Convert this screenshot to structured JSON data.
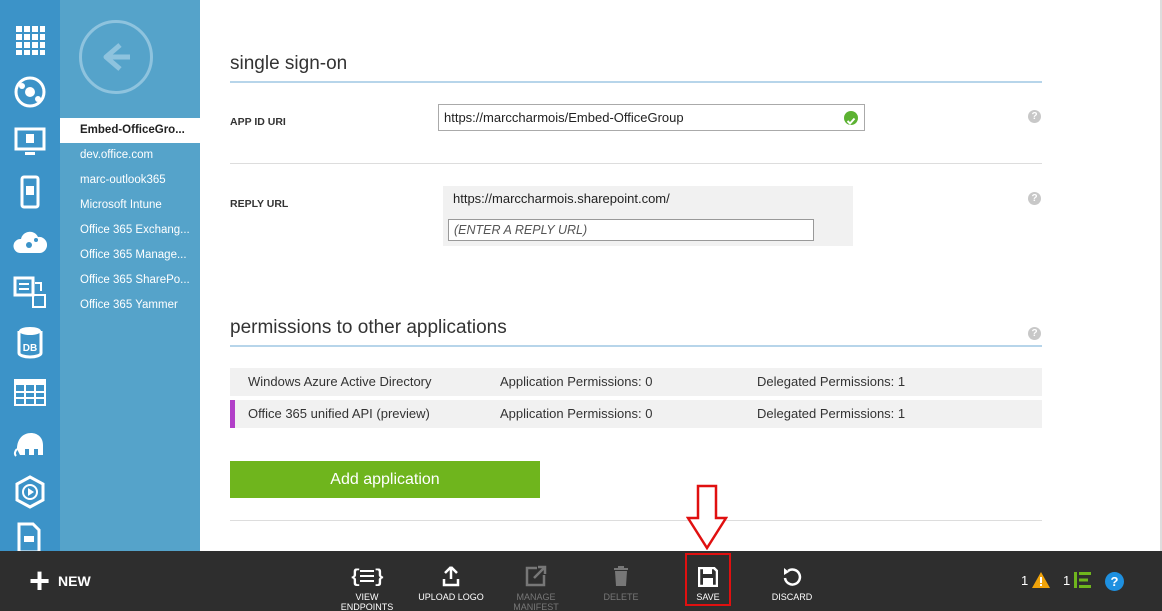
{
  "rail": {
    "icons": [
      "all-items-grid-icon",
      "web-sites-icon",
      "virtual-machines-icon",
      "mobile-services-icon",
      "cloud-services-icon",
      "batch-services-icon",
      "sql-database-icon",
      "storage-table-icon",
      "hdinsight-elephant-icon",
      "media-services-icon",
      "reports-icon"
    ]
  },
  "app_list": {
    "items": [
      "Embed-OfficeGro...",
      "dev.office.com",
      "marc-outlook365",
      "Microsoft Intune",
      "Office 365 Exchang...",
      "Office 365 Manage...",
      "Office 365 SharePo...",
      "Office 365 Yammer"
    ]
  },
  "sso": {
    "title": "single sign-on",
    "app_id_label": "APP ID URI",
    "app_id_value": "https://marccharmois/Embed-OfficeGroup",
    "reply_label": "REPLY URL",
    "reply_value": "https://marccharmois.sharepoint.com/",
    "reply_placeholder": "(ENTER A REPLY URL)"
  },
  "permissions": {
    "title": "permissions to other applications",
    "rows": [
      {
        "app": "Windows Azure Active Directory",
        "app_perms": "Application Permissions: 0",
        "delegated": "Delegated Permissions: 1"
      },
      {
        "app": "Office 365 unified API (preview)",
        "app_perms": "Application Permissions: 0",
        "delegated": "Delegated Permissions: 1"
      }
    ],
    "add_button": "Add application"
  },
  "help_glyph": "?",
  "cmdbar": {
    "new_label": "NEW",
    "commands": {
      "view_endpoints": "VIEW ENDPOINTS",
      "upload_logo": "UPLOAD LOGO",
      "manage_manifest_1": "MANAGE",
      "manage_manifest_2": "MANIFEST",
      "delete": "DELETE",
      "save": "SAVE",
      "discard": "DISCARD"
    },
    "warnings_count": "1",
    "activity_count": "1",
    "help_glyph": "?"
  },
  "colors": {
    "rail": "#3c93c8",
    "panel": "#55a3ca",
    "cmdbar": "#2e2e2e",
    "accent_green": "#6fb51d",
    "highlight_red": "#e01010",
    "selected_marker": "#b13fc8"
  }
}
